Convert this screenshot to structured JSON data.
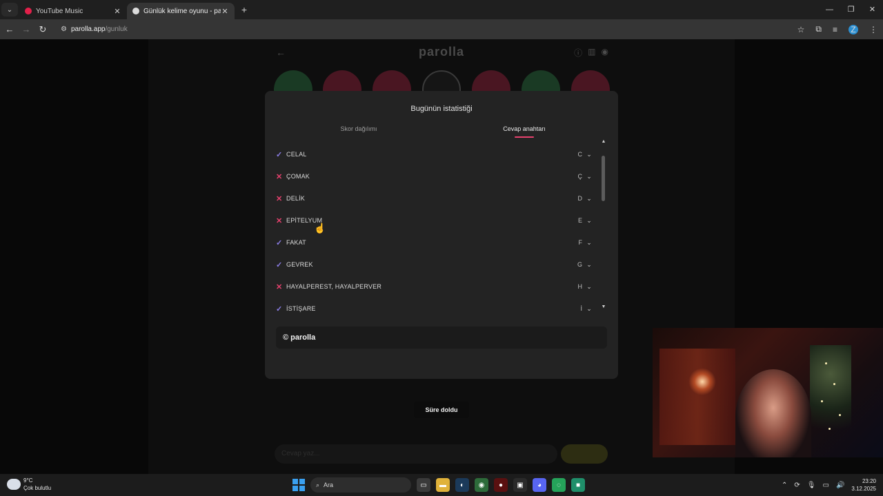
{
  "browser": {
    "tabs": [
      {
        "title": "YouTube Music",
        "active": false,
        "favicon": "youtube-music-icon"
      },
      {
        "title": "Günlük kelime oyunu - parolla",
        "active": true,
        "favicon": "parolla-icon"
      }
    ],
    "url_host": "parolla.app",
    "url_path": "/gunluk",
    "profile_initial": "Z"
  },
  "app": {
    "logo": "parolla",
    "bottom_input_placeholder": "Cevap yaz..."
  },
  "modal": {
    "title": "Bugünün istatistiği",
    "tab_score": "Skor dağılımı",
    "tab_answers": "Cevap anahtarı",
    "active_tab": "Cevap anahtarı",
    "answers": [
      {
        "word": "CELAL",
        "letter": "C",
        "correct": true
      },
      {
        "word": "ÇOMAK",
        "letter": "Ç",
        "correct": false
      },
      {
        "word": "DELİK",
        "letter": "D",
        "correct": false
      },
      {
        "word": "EPİTELYUM",
        "letter": "E",
        "correct": false
      },
      {
        "word": "FAKAT",
        "letter": "F",
        "correct": true
      },
      {
        "word": "GEVREK",
        "letter": "G",
        "correct": true
      },
      {
        "word": "HAYALPEREST, HAYALPERVER",
        "letter": "H",
        "correct": false
      },
      {
        "word": "İSTİŞARE",
        "letter": "İ",
        "correct": true
      }
    ],
    "footer_text": "© parolla",
    "timeout_button": "Süre doldu"
  },
  "taskbar": {
    "temperature": "9°C",
    "weather": "Çok bulutlu",
    "search_label": "Ara",
    "time": "23:20",
    "date": "3.12.2025"
  },
  "colors": {
    "correct": "#8c7ee8",
    "wrong": "#e8416e",
    "accent": "#e8416e"
  }
}
